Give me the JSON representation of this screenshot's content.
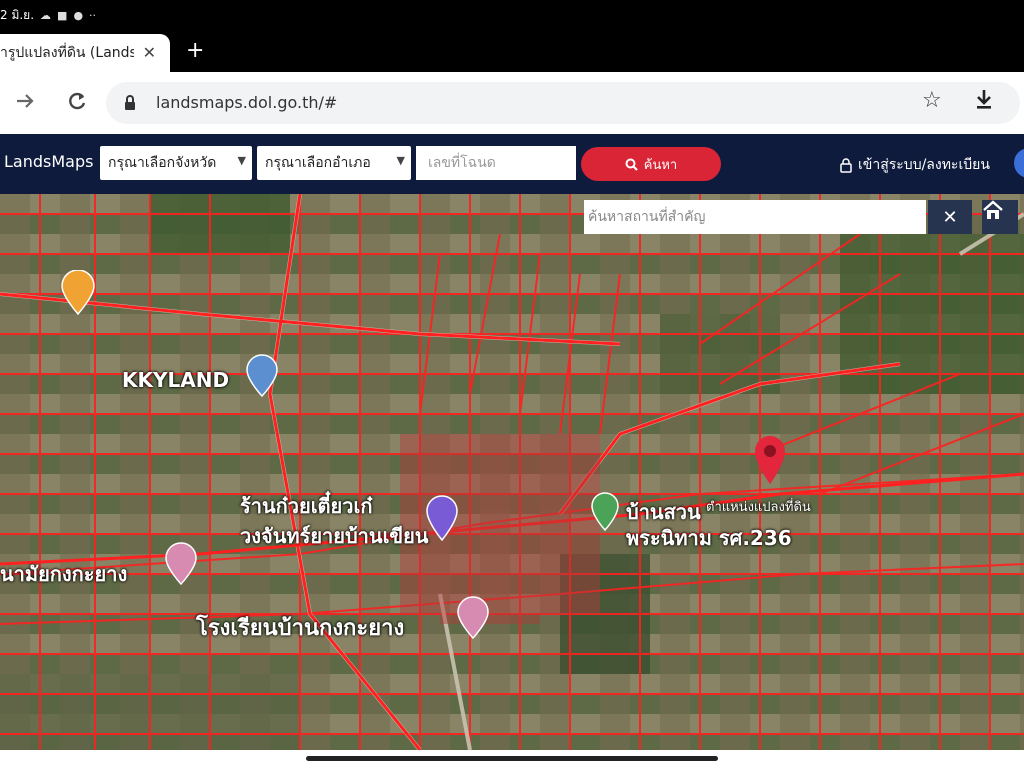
{
  "statusbar": {
    "time": "2 มิ.ย.",
    "icons": [
      "cloud-icon",
      "facebook-icon",
      "messenger-icon",
      "more-icon"
    ],
    "more": "··"
  },
  "browser": {
    "tab_title": "ารูปแปลงที่ดิน (Lands",
    "tab_close": "✕",
    "new_tab": "+",
    "url": "landsmaps.dol.go.th/#"
  },
  "header": {
    "brand": "LandsMaps",
    "province_select": "กรุณาเลือกจังหวัด",
    "district_select": "กรุณาเลือกอำเภอ",
    "deed_placeholder": "เลขที่โฉนด",
    "search_label": "ค้นหา",
    "login_label": "เข้าสู่ระบบ/ลงทะเบียน"
  },
  "map": {
    "place_search_placeholder": "ค้นหาสถานที่สำคัญ",
    "clear_label": "✕",
    "labels": {
      "kkyland": "KKYLAND",
      "shop": "ร้านก๋วยเตี๋ยวเก๋",
      "shop2": "วงจันทร์ยายบ้านเขียน",
      "health": "นามัยกงกะยาง",
      "school": "โรงเรียนบ้านกงกะยาง",
      "village": "บ้านสวน",
      "temple": "พระนิทาม รศ.236",
      "parcel": "ตำแหน่งแปลงที่ดิน"
    }
  },
  "colors": {
    "header_bg": "#0e1b3d",
    "search_red": "#d92535",
    "parcel_line": "#ff2020",
    "map_dark": "#27344f"
  }
}
